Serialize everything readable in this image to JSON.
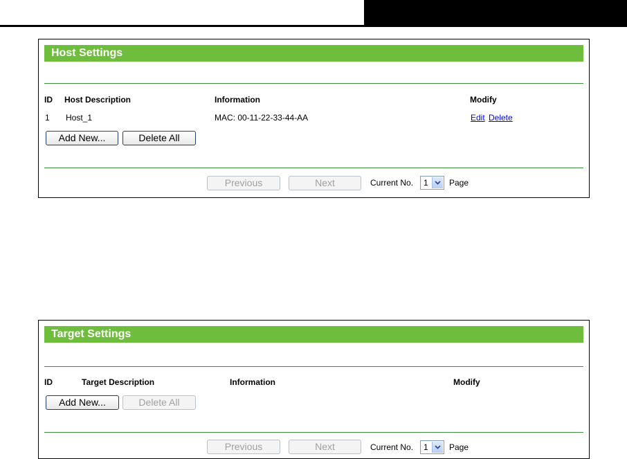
{
  "host_panel": {
    "title": "Host Settings",
    "columns": [
      "ID",
      "Host Description",
      "Information",
      "Modify"
    ],
    "rows": [
      {
        "id": "1",
        "description": "Host_1",
        "information": "MAC: 00-11-22-33-44-AA",
        "edit": "Edit",
        "delete": "Delete"
      }
    ],
    "add_new": "Add New...",
    "delete_all": "Delete All",
    "previous": "Previous",
    "next": "Next",
    "current_no_label": "Current No.",
    "current_no_value": "1",
    "page_label": "Page"
  },
  "target_panel": {
    "title": "Target Settings",
    "columns": [
      "ID",
      "Target Description",
      "Information",
      "Modify"
    ],
    "add_new": "Add New...",
    "delete_all": "Delete All",
    "previous": "Previous",
    "next": "Next",
    "current_no_label": "Current No.",
    "current_no_value": "1",
    "page_label": "Page"
  },
  "colors": {
    "title_bar": "#6ebd3c",
    "divider": "#3d8f3d",
    "link": "#0000ee"
  },
  "icons": {
    "dropdown": "chevron-down-icon"
  }
}
